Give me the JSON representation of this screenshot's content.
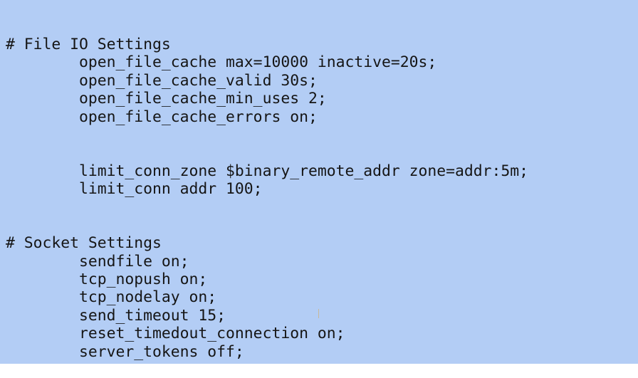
{
  "editor": {
    "lines": [
      {
        "text": "# File IO Settings",
        "indent": false
      },
      {
        "text": "open_file_cache max=10000 inactive=20s;",
        "indent": true
      },
      {
        "text": "open_file_cache_valid 30s;",
        "indent": true
      },
      {
        "text": "open_file_cache_min_uses 2;",
        "indent": true
      },
      {
        "text": "open_file_cache_errors on;",
        "indent": true
      },
      {
        "text": "",
        "indent": false
      },
      {
        "text": "",
        "indent": false
      },
      {
        "text": "limit_conn_zone $binary_remote_addr zone=addr:5m;",
        "indent": true
      },
      {
        "text": "limit_conn addr 100;",
        "indent": true
      },
      {
        "text": "",
        "indent": false
      },
      {
        "text": "",
        "indent": false
      },
      {
        "text": "# Socket Settings",
        "indent": false
      },
      {
        "text": "sendfile on;",
        "indent": true
      },
      {
        "text": "tcp_nopush on;",
        "indent": true
      },
      {
        "text": "tcp_nodelay on;",
        "indent": true
      },
      {
        "text": "send_timeout 15;",
        "indent": true
      },
      {
        "text": "reset_timedout_connection on;",
        "indent": true
      },
      {
        "text": "server_tokens off;",
        "indent": true
      }
    ]
  },
  "colors": {
    "background": "#b3cdf5",
    "text": "#151515"
  }
}
